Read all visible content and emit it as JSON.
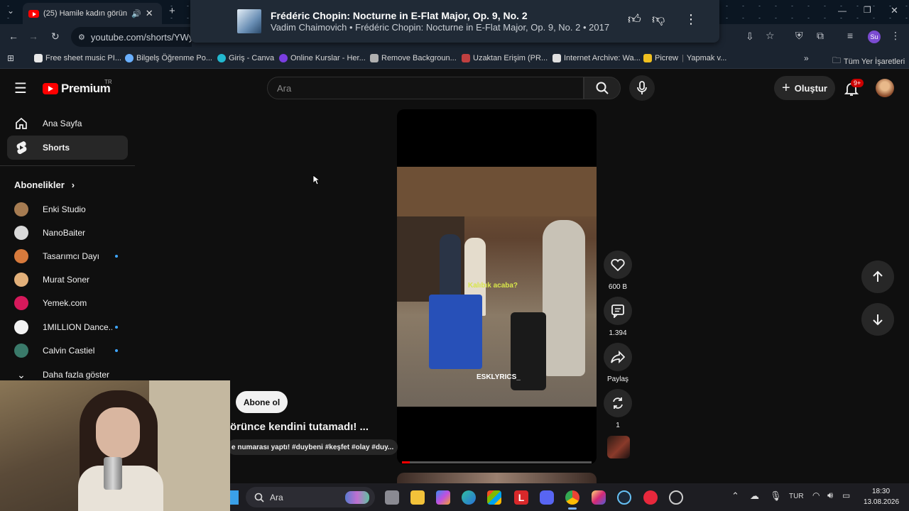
{
  "browser": {
    "tab_title": "(25) Hamile kadın görünce",
    "url_visible": "youtube.com/shorts/YWyD",
    "bookmarks": [
      {
        "label": "Free sheet music PI...",
        "color": "#e8e8e8"
      },
      {
        "label": "Bilgelş Öğrenme Po...",
        "color": "#6ab0ff"
      },
      {
        "label": "Giriş - Canva",
        "color": "#22b8cf"
      },
      {
        "label": "Online Kurslar - Her...",
        "color": "#7a3ee0"
      },
      {
        "label": "Remove Backgroun...",
        "color": "#b0b0b0"
      },
      {
        "label": "Uzaktan Erişim (PR...",
        "color": "#c04040"
      },
      {
        "label": "Internet Archive: Wa...",
        "color": "#e0e0e0"
      },
      {
        "label": "Picrew",
        "color": "#f0c020"
      },
      {
        "label": "Yapmak v...",
        "color": "#888888"
      }
    ],
    "all_bookmarks_label": "Tüm Yer İşaretleri",
    "profile_initials": "Su"
  },
  "media_popup": {
    "title": "Frédéric Chopin: Nocturne in E-Flat Major, Op. 9, No. 2",
    "subtitle": "Vadim Chaimovich • Frédéric Chopin: Nocturne in E-Flat Major, Op. 9, No. 2 • 2017"
  },
  "youtube": {
    "logo_text": "Premium",
    "region": "TR",
    "search_placeholder": "Ara",
    "create_label": "Oluştur",
    "notification_count": "9+"
  },
  "sidebar": {
    "items": [
      {
        "label": "Ana Sayfa",
        "icon": "home-icon"
      },
      {
        "label": "Shorts",
        "icon": "shorts-icon"
      }
    ],
    "subscriptions_title": "Abonelikler",
    "subscriptions": [
      {
        "name": "Enki Studio",
        "color": "#a67c52",
        "new": false
      },
      {
        "name": "NanoBaiter",
        "color": "#d9d9d9",
        "new": false
      },
      {
        "name": "Tasarımcı Dayı",
        "color": "#d77a3c",
        "new": true
      },
      {
        "name": "Murat Soner",
        "color": "#e2b07a",
        "new": false
      },
      {
        "name": "Yemek.com",
        "color": "#d6195b",
        "new": false
      },
      {
        "name": "1MILLION Dance...",
        "color": "#f2f2f2",
        "new": true
      },
      {
        "name": "Calvin Castiel",
        "color": "#3a7a6a",
        "new": true
      }
    ],
    "show_more_label": "Daha fazla göster"
  },
  "short": {
    "subscribe_label": "Abone ol",
    "title_fragment": "örünce kendini tutamadı! ...",
    "hashtags_fragment": "e numarası yaptı! #duybeni #keşfet #olay #duy...",
    "caption": "Kalıbık acaba?",
    "watermark": "ESKLYRICS_",
    "likes": "600 B",
    "comments": "1.394",
    "share_label": "Paylaş",
    "remix_count": "1",
    "progress": 0.04
  },
  "taskbar": {
    "search_label": "Ara",
    "language": "TUR",
    "time": "18:30",
    "date": "13.08.2026"
  }
}
